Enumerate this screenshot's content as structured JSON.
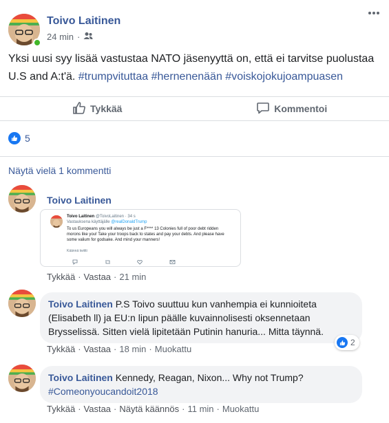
{
  "post": {
    "author": "Toivo Laitinen",
    "time": "24 min",
    "separator": "·",
    "audience_icon": "friends-icon",
    "text_plain": "Yksi uusi syy lisää vastustaa NATO jäsenyyttä on, että ei tarvitse puolustaa U.S and A:t'ä. ",
    "hashtags": [
      "#trumpvituttaa",
      "#hernenenään",
      "#voiskojokujoampuasen"
    ]
  },
  "actions": {
    "like_label": "Tykkää",
    "comment_label": "Kommentoi"
  },
  "reactions": {
    "count": "5"
  },
  "more_comments_label": "Näytä vielä 1 kommentti",
  "comments": [
    {
      "author": "Toivo Laitinen",
      "tweet": {
        "name": "Toivo Laitinen",
        "handle": "@ToivoLaitinen · 34 s",
        "reply_prefix": "Vastauksena käyttäjälle",
        "reply_to": "@realDonaldTrump",
        "body": "To us Europeans you will always be just a F**** 13 Colonies full of poor debt ridden morons like you! Take your troops back to states and pay your debts. And please have some valium for godsake. And mind your manners!",
        "translate": "Käännä twiitti",
        "icons": [
          "reply-icon",
          "retweet-icon",
          "like-icon",
          "dm-icon"
        ]
      },
      "like": "Tykkää",
      "reply": "Vastaa",
      "time": "21 min"
    },
    {
      "author": "Toivo Laitinen",
      "text": "P.S Toivo suuttuu kun vanhempia ei kunnioiteta (Elisabeth ll) ja EU:n lipun päälle kuvainnolisesti oksennetaan Brysselissä. Sitten vielä lipitetään Putinin hanuria... Mitta täynnä.",
      "like": "Tykkää",
      "reply": "Vastaa",
      "time": "18 min",
      "edited": "Muokattu",
      "reaction_count": "2"
    },
    {
      "author": "Toivo Laitinen",
      "text": "Kennedy, Reagan, Nixon... Why not Trump?",
      "hashtag": "#Comeonyoucandoit2018",
      "like": "Tykkää",
      "reply": "Vastaa",
      "translate": "Näytä käännös",
      "time": "11 min",
      "edited": "Muokattu"
    }
  ],
  "colors": {
    "link": "#385898",
    "muted": "#606770",
    "like_blue": "#1877f2",
    "bubble": "#f2f3f5",
    "online": "#42b72a"
  }
}
